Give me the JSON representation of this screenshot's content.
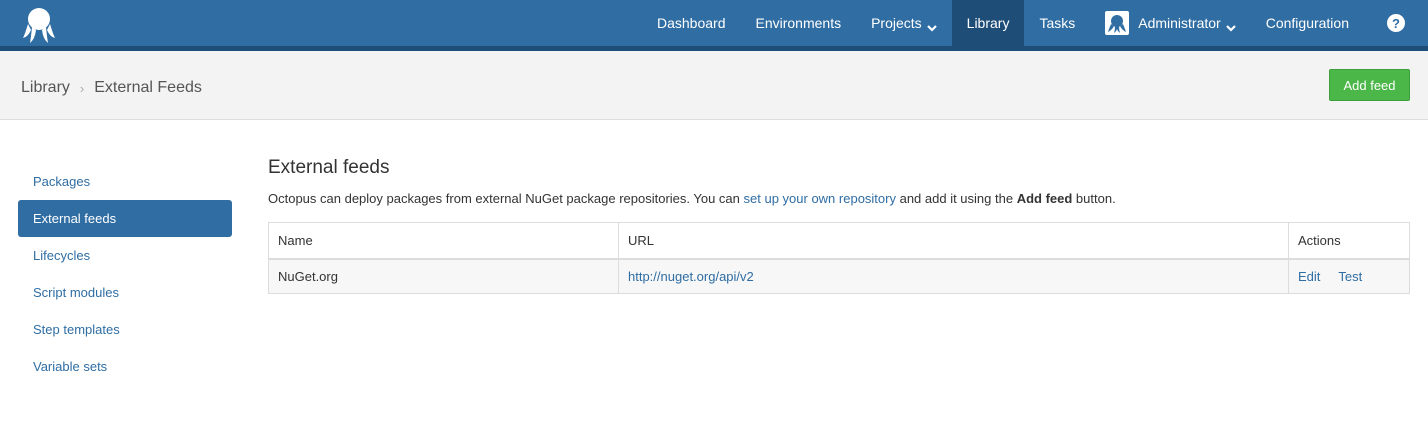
{
  "nav": {
    "logo_icon": "octopus-logo-icon",
    "items": [
      {
        "label": "Dashboard"
      },
      {
        "label": "Environments"
      },
      {
        "label": "Projects"
      },
      {
        "label": "Library"
      },
      {
        "label": "Tasks"
      },
      {
        "label": "Administrator"
      },
      {
        "label": "Configuration"
      }
    ],
    "help_label": "?",
    "active": "Library"
  },
  "breadcrumb": {
    "root": "Library",
    "separator": "›",
    "current": "External Feeds"
  },
  "header": {
    "add_button_label": "Add feed"
  },
  "sidebar": {
    "items": [
      {
        "label": "Packages"
      },
      {
        "label": "External feeds"
      },
      {
        "label": "Lifecycles"
      },
      {
        "label": "Script modules"
      },
      {
        "label": "Step templates"
      },
      {
        "label": "Variable sets"
      }
    ],
    "active": "External feeds"
  },
  "main": {
    "title": "External feeds",
    "desc_before": "Octopus can deploy packages from external NuGet package repositories. You can ",
    "desc_link": "set up your own repository",
    "desc_middle": " and add it using the ",
    "desc_bold": "Add feed",
    "desc_after": " button."
  },
  "table": {
    "headers": {
      "name": "Name",
      "url": "URL",
      "actions": "Actions"
    },
    "rows": [
      {
        "name": "NuGet.org",
        "url": "http://nuget.org/api/v2",
        "edit": "Edit",
        "test": "Test"
      }
    ]
  },
  "colors": {
    "nav_bg": "#2f6da3",
    "nav_active": "#1e4d78",
    "link": "#2f6da3",
    "add_button": "#4cb749"
  }
}
